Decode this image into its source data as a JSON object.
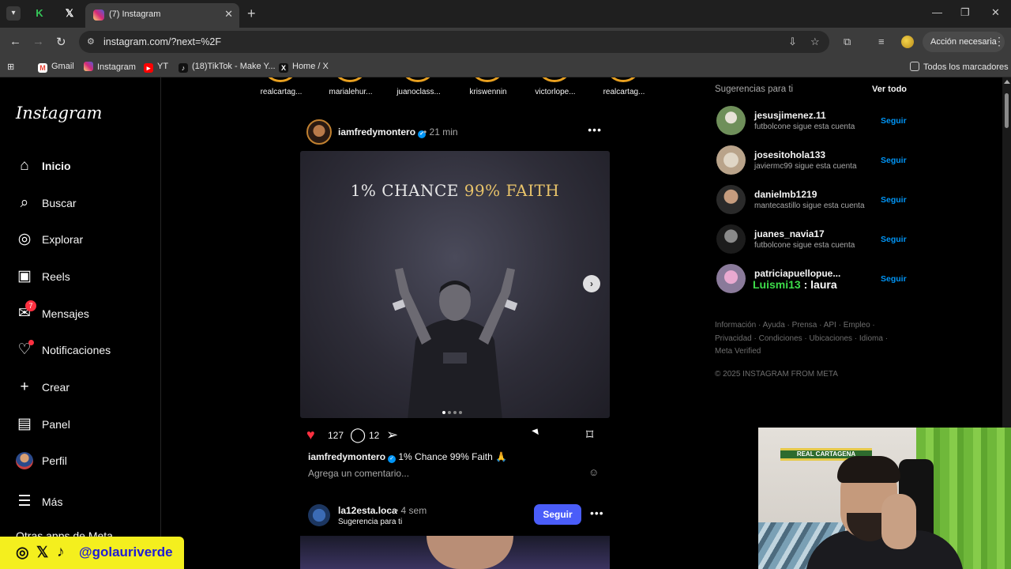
{
  "browser": {
    "active_tab_title": "(7) Instagram",
    "url": "instagram.com/?next=%2F",
    "action_button": "Acción necesaria",
    "bookmarks": [
      {
        "label": "Gmail",
        "icon": "gmail-icon",
        "color": "#ea4335"
      },
      {
        "label": "Instagram",
        "icon": "instagram-icon",
        "color": "#d62976"
      },
      {
        "label": "YT",
        "icon": "youtube-icon",
        "color": "#ff0000"
      },
      {
        "label": "(18)TikTok - Make Y...",
        "icon": "tiktok-icon",
        "color": "#111111"
      },
      {
        "label": "Home / X",
        "icon": "x-icon",
        "color": "#111111"
      }
    ],
    "all_bookmarks": "Todos los marcadores"
  },
  "sidebar": {
    "logo": "Instagram",
    "items": [
      {
        "label": "Inicio",
        "icon": "home-icon"
      },
      {
        "label": "Buscar",
        "icon": "search-icon"
      },
      {
        "label": "Explorar",
        "icon": "compass-icon"
      },
      {
        "label": "Reels",
        "icon": "reels-icon"
      },
      {
        "label": "Mensajes",
        "icon": "messenger-icon",
        "badge": "7"
      },
      {
        "label": "Notificaciones",
        "icon": "heart-icon"
      },
      {
        "label": "Crear",
        "icon": "plus-icon"
      },
      {
        "label": "Panel",
        "icon": "chart-icon"
      },
      {
        "label": "Perfil",
        "icon": "avatar-icon"
      },
      {
        "label": "Más",
        "icon": "menu-icon"
      }
    ],
    "other_meta": "Otras apps de Meta"
  },
  "stories": [
    "realcartag...",
    "marialehur...",
    "juanoclass...",
    "kriswennin",
    "victorlope...",
    "realcartag..."
  ],
  "post": {
    "username": "iamfredymontero",
    "time": "21 min",
    "image_text_white": "1% CHANCE ",
    "image_text_gold": "99% FAITH",
    "likes": "127",
    "comments": "12",
    "caption": "1% Chance 99% Faith 🙏",
    "comment_placeholder": "Agrega un comentario..."
  },
  "post2": {
    "username": "la12esta.loca",
    "time": "4 sem",
    "suggestion": "Sugerencia para ti",
    "follow": "Seguir"
  },
  "suggestions": {
    "title": "Sugerencias para ti",
    "see_all": "Ver todo",
    "items": [
      {
        "name": "jesusjimenez.11",
        "sub": "futbolcone sigue esta cuenta",
        "follow": "Seguir",
        "color": "#6f8f5a"
      },
      {
        "name": "josesitohola133",
        "sub": "javiermc99 sigue esta cuenta",
        "follow": "Seguir",
        "color": "#b9a38a"
      },
      {
        "name": "danielmb1219",
        "sub": "mantecastillo sigue esta cuenta",
        "follow": "Seguir",
        "color": "#8a6a52"
      },
      {
        "name": "juanes_navia17",
        "sub": "futbolcone sigue esta cuenta",
        "follow": "Seguir",
        "color": "#4a4a4a"
      },
      {
        "name": "patriciapuellopue...",
        "sub": "",
        "follow": "Seguir",
        "color": "#c66aa8"
      }
    ],
    "overlay_green": "Luismi13",
    "overlay_white": "laura"
  },
  "footer": {
    "links": [
      "Información",
      "Ayuda",
      "Prensa",
      "API",
      "Empleo",
      "Privacidad",
      "Condiciones",
      "Ubicaciones",
      "Idioma",
      "Meta Verified"
    ],
    "copyright": "© 2025 INSTAGRAM FROM META"
  },
  "webcam": {
    "scarf_text": "REAL CARTAGENA"
  },
  "social": {
    "handle": "@golauriverde"
  },
  "colors": {
    "accent": "#0095f6",
    "like": "#ff3040",
    "follow_button": "#4a5df9",
    "banner": "#f4ef1e"
  }
}
